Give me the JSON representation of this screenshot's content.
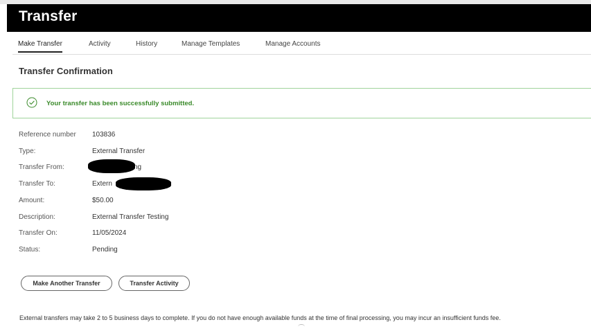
{
  "header": {
    "title": "Transfer"
  },
  "tabs": [
    {
      "label": "Make Transfer",
      "active": true
    },
    {
      "label": "Activity",
      "active": false
    },
    {
      "label": "History",
      "active": false
    },
    {
      "label": "Manage Templates",
      "active": false
    },
    {
      "label": "Manage Accounts",
      "active": false
    }
  ],
  "section_title": "Transfer Confirmation",
  "success": {
    "message": "Your transfer has been successfully submitted.",
    "icon": "check-circle-icon",
    "color": "#3a8a2a",
    "border_color": "#9fd39a"
  },
  "details": {
    "reference": {
      "label": "Reference number",
      "value": "103836"
    },
    "type": {
      "label": "Type:",
      "value": "External Transfer"
    },
    "from": {
      "label": "Transfer From:",
      "value": "ng"
    },
    "to": {
      "label": "Transfer To:",
      "value": "Extern"
    },
    "amount": {
      "label": "Amount:",
      "value": "$50.00"
    },
    "description": {
      "label": "Description:",
      "value": "External Transfer Testing"
    },
    "date": {
      "label": "Transfer On:",
      "value": "11/05/2024"
    },
    "status": {
      "label": "Status:",
      "value": "Pending"
    }
  },
  "buttons": {
    "make_another": "Make Another Transfer",
    "activity": "Transfer Activity"
  },
  "footnote": "External transfers may take 2 to 5 business days to complete. If you do not have enough available funds at the time of final processing, you may incur an insufficient funds fee."
}
